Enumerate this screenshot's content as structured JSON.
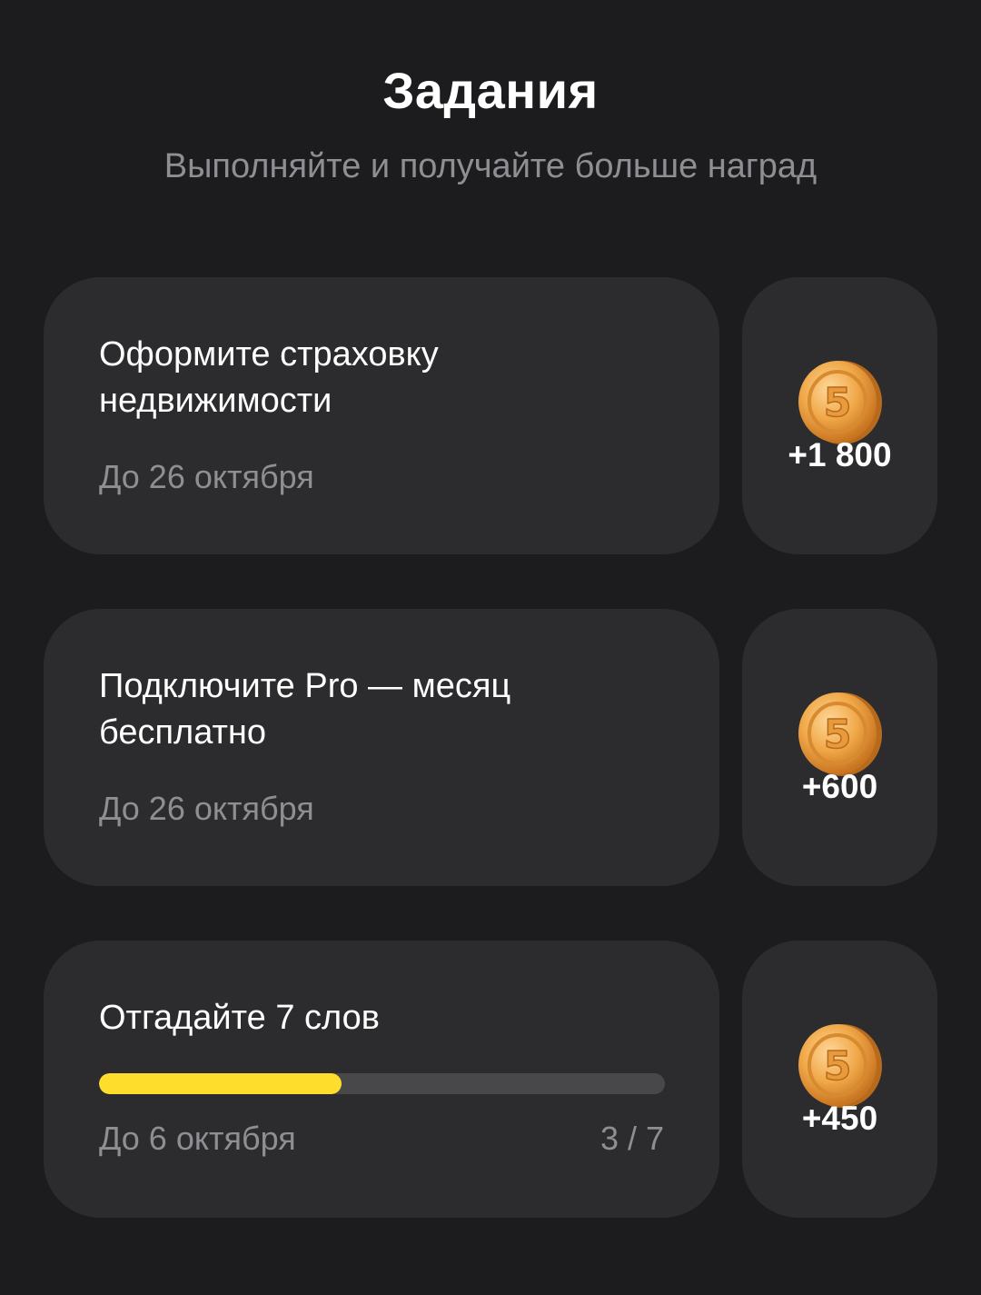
{
  "header": {
    "title": "Задания",
    "subtitle": "Выполняйте и получайте больше наград"
  },
  "tasks": [
    {
      "title": "Оформите страховку недвижимости",
      "deadline": "До 26 октября",
      "reward": "+1 800",
      "coin_icon": "coin-5-icon"
    },
    {
      "title": "Подключите Pro — месяц бесплатно",
      "deadline": "До 26 октября",
      "reward": "+600",
      "coin_icon": "coin-5-icon"
    },
    {
      "title": "Отгадайте 7 слов",
      "deadline": "До 6 октября",
      "reward": "+450",
      "coin_icon": "coin-5-icon",
      "progress": {
        "current": 3,
        "total": 7,
        "label": "3 / 7"
      }
    }
  ],
  "colors": {
    "background": "#1c1c1e",
    "card": "#2c2c2e",
    "secondary_text": "#8e8e93",
    "progress_fill": "#ffdd2d",
    "progress_track": "#48484a",
    "coin": "#f0a848"
  }
}
